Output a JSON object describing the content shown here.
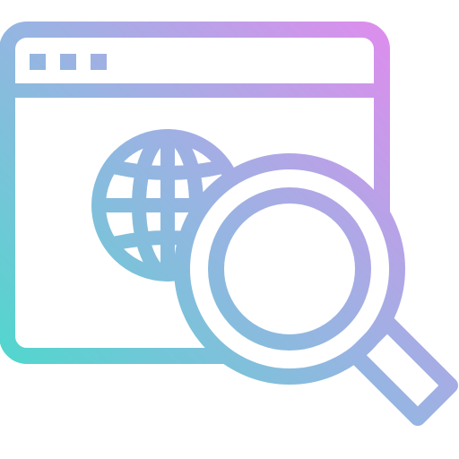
{
  "icon": {
    "name": "web-search-icon",
    "gradient": {
      "start": "#3EE0C8",
      "mid": "#98B4E2",
      "end": "#F083F0"
    },
    "background": "#FFFFFF"
  },
  "browser_window": {
    "icon": "browser-window-icon",
    "dots": [
      "dot",
      "dot",
      "dot"
    ]
  },
  "globe": {
    "icon": "globe-icon"
  },
  "magnifier": {
    "icon": "magnifying-glass-icon"
  }
}
